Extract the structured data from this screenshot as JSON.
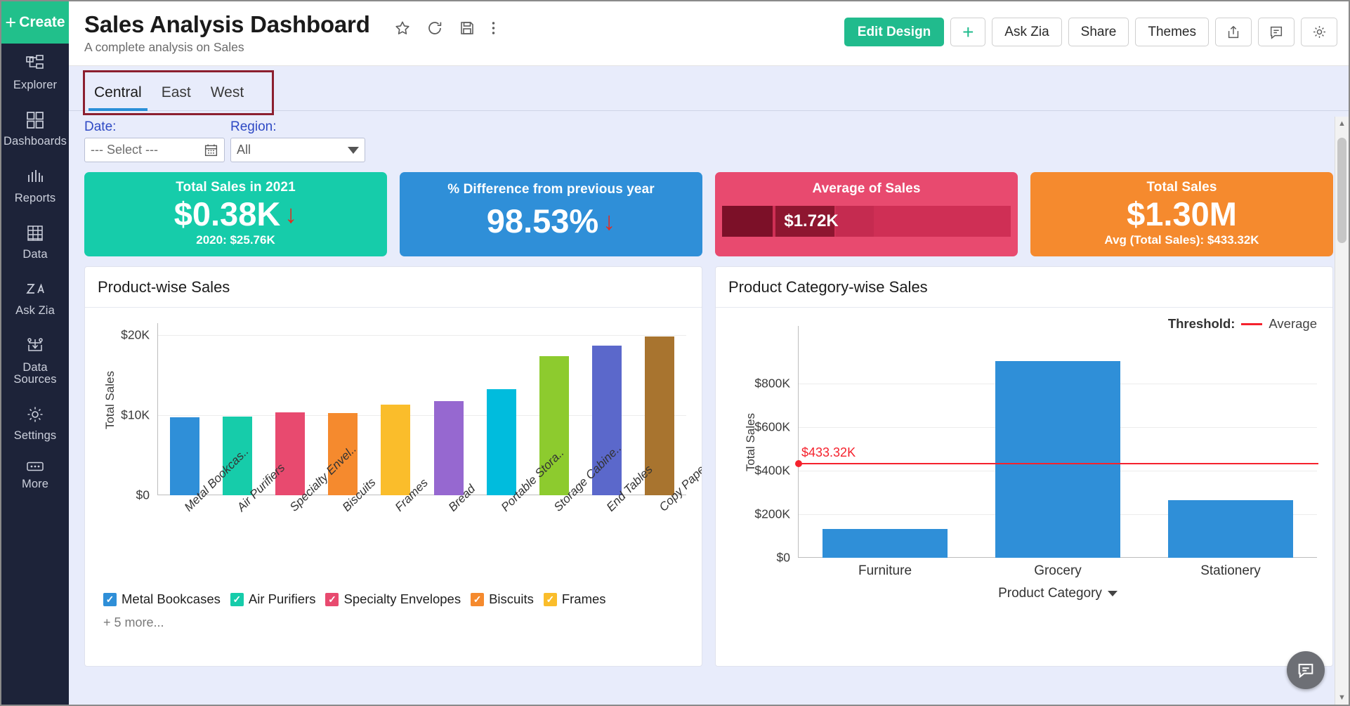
{
  "sidebar": {
    "create_label": "Create",
    "items": [
      {
        "label": "Explorer",
        "icon": "explorer-icon"
      },
      {
        "label": "Dashboards",
        "icon": "dashboards-icon"
      },
      {
        "label": "Reports",
        "icon": "reports-icon"
      },
      {
        "label": "Data",
        "icon": "data-table-icon"
      },
      {
        "label": "Ask Zia",
        "icon": "ask-zia-icon"
      },
      {
        "label": "Data Sources",
        "icon": "data-sources-icon"
      },
      {
        "label": "Settings",
        "icon": "gear-icon"
      },
      {
        "label": "More",
        "icon": "ellipsis-icon"
      }
    ],
    "collapse_icon": "collapse-arrow-icon"
  },
  "header": {
    "title": "Sales Analysis Dashboard",
    "subtitle": "A complete analysis on Sales",
    "title_icons": [
      "star-icon",
      "refresh-icon",
      "save-icon",
      "more-vertical-icon"
    ],
    "actions": {
      "edit_design": "Edit Design",
      "add": "+",
      "ask_zia": "Ask Zia",
      "share": "Share",
      "themes": "Themes",
      "export_icon": "export-icon",
      "comment_icon": "comment-icon",
      "settings_icon": "gear-icon"
    }
  },
  "tabs": [
    {
      "label": "Central",
      "active": true
    },
    {
      "label": "East",
      "active": false
    },
    {
      "label": "West",
      "active": false
    }
  ],
  "filters": [
    {
      "label": "Date:",
      "value": "--- Select ---",
      "type": "date"
    },
    {
      "label": "Region:",
      "value": "All",
      "type": "select"
    }
  ],
  "kpis": [
    {
      "title": "Total Sales in 2021",
      "value": "$0.38K",
      "trend": "↓",
      "sub": "2020: $25.76K",
      "color": "#16ccaa"
    },
    {
      "title": "% Difference from previous year",
      "value": "98.53%",
      "trend": "↓",
      "sub": "",
      "color": "#2f8fd8"
    },
    {
      "title": "Average of Sales",
      "value": "$1.72K",
      "trend": "",
      "sub": "",
      "color": "#e84a6f"
    },
    {
      "title": "Total Sales",
      "value": "$1.30M",
      "trend": "",
      "sub": "Avg (Total Sales): $433.32K",
      "color": "#f58a2e"
    }
  ],
  "cards": {
    "left_title": "Product-wise Sales",
    "right_title": "Product Category-wise Sales"
  },
  "legend": {
    "items": [
      {
        "label": "Metal Bookcases",
        "color": "#2f8fd8",
        "checked": true
      },
      {
        "label": "Air Purifiers",
        "color": "#16ccaa",
        "checked": true
      },
      {
        "label": "Specialty Envelopes",
        "color": "#e84a6f",
        "checked": true
      },
      {
        "label": "Biscuits",
        "color": "#f58a2e",
        "checked": true
      },
      {
        "label": "Frames",
        "color": "#fabd2b",
        "checked": true
      }
    ],
    "more": "+ 5 more...",
    "check_glyph": "✓"
  },
  "threshold_legend": {
    "label": "Threshold:",
    "name": "Average",
    "color": "#f5222d"
  },
  "chart_data": [
    {
      "type": "bar",
      "title": "Product-wise Sales",
      "xlabel": "",
      "ylabel": "Total Sales",
      "categories": [
        "Metal Bookcas..",
        "Air Purifiers",
        "Specialty Envel..",
        "Biscuits",
        "Frames",
        "Bread",
        "Portable Stora..",
        "Storage Cabine..",
        "End Tables",
        "Copy Paper"
      ],
      "values": [
        9700,
        9800,
        10350,
        10300,
        11350,
        11800,
        12200,
        13250,
        17400,
        18700,
        19850
      ],
      "bar_values": [
        9700,
        9800,
        10350,
        10300,
        11350,
        11800,
        13250,
        17400,
        18700,
        19850
      ],
      "colors": [
        "#2f8fd8",
        "#16ccaa",
        "#e84a6f",
        "#f58a2e",
        "#fabd2b",
        "#9668d0",
        "#00bcdd",
        "#8dcb2e",
        "#5b68cb",
        "#a8742f"
      ],
      "ytick_labels": [
        "$20K",
        "$10K",
        "$0"
      ],
      "ytick_values": [
        20000,
        10000,
        0
      ],
      "ylim": [
        0,
        21500
      ],
      "grid": true,
      "legend_position": "bottom"
    },
    {
      "type": "bar",
      "title": "Product Category-wise Sales",
      "xlabel": "Product Category",
      "ylabel": "Total Sales",
      "categories": [
        "Furniture",
        "Grocery",
        "Stationery"
      ],
      "values": [
        131000,
        902000,
        265000
      ],
      "series": [
        {
          "name": "Total Sales",
          "values": [
            131000,
            902000,
            265000
          ],
          "color": "#2f8fd8"
        }
      ],
      "ytick_labels": [
        "$800K",
        "$600K",
        "$400K",
        "$200K",
        "$0"
      ],
      "ytick_values": [
        800000,
        600000,
        400000,
        200000,
        0
      ],
      "ylim": [
        0,
        960000
      ],
      "threshold": {
        "label": "$433.32K",
        "value": 433320,
        "color": "#f5222d",
        "name": "Average"
      },
      "grid": true,
      "legend_position": "top-right"
    }
  ],
  "chat_fab_icon": "chat-bubble-icon"
}
